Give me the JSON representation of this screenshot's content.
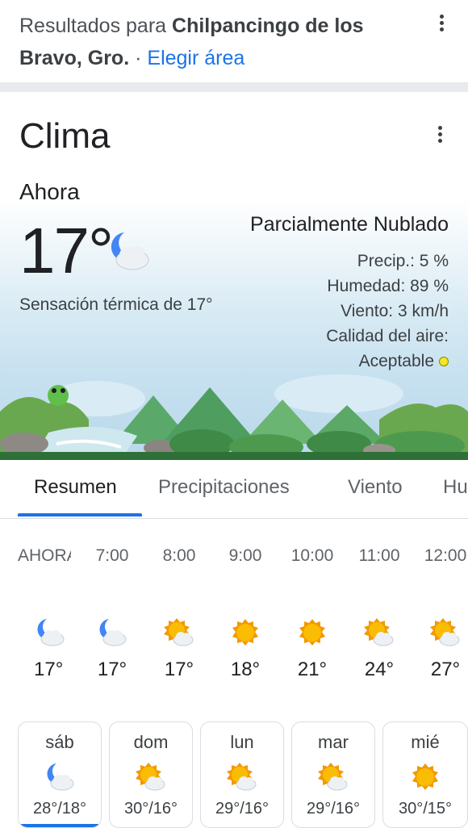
{
  "header": {
    "results_prefix": "Resultados para",
    "location_line1": "Chilpancingo de los",
    "location_line2": "Bravo, Gro.",
    "dot": "·",
    "choose_area": "Elegir área"
  },
  "weather": {
    "title": "Clima",
    "now_label": "Ahora",
    "temperature": "17°",
    "current_icon": "moon-cloud-icon",
    "feels_like": "Sensación térmica de 17°",
    "condition": "Parcialmente Nublado",
    "precip": "Precip.: 5 %",
    "humidity": "Humedad: 89 %",
    "wind": "Viento: 3 km/h",
    "air_quality_label": "Calidad del aire:",
    "air_quality_value": "Aceptable",
    "air_quality_color": "#f5e81e"
  },
  "tabs": [
    {
      "label": "Resumen",
      "active": true
    },
    {
      "label": "Precipitaciones",
      "active": false
    },
    {
      "label": "Viento",
      "active": false
    },
    {
      "label": "Hu",
      "active": false
    }
  ],
  "hourly": [
    {
      "time": "AHORA",
      "icon": "moon-cloud-icon",
      "temp": "17°"
    },
    {
      "time": "7:00",
      "icon": "moon-cloud-icon",
      "temp": "17°"
    },
    {
      "time": "8:00",
      "icon": "sun-cloud-icon",
      "temp": "17°"
    },
    {
      "time": "9:00",
      "icon": "sun-icon",
      "temp": "18°"
    },
    {
      "time": "10:00",
      "icon": "sun-icon",
      "temp": "21°"
    },
    {
      "time": "11:00",
      "icon": "sun-cloud-icon",
      "temp": "24°"
    },
    {
      "time": "12:00",
      "icon": "sun-cloud-icon",
      "temp": "27°"
    }
  ],
  "daily": [
    {
      "day": "sáb",
      "icon": "moon-cloud-icon",
      "temps": "28°/18°",
      "selected": true
    },
    {
      "day": "dom",
      "icon": "sun-cloud-icon",
      "temps": "30°/16°",
      "selected": false
    },
    {
      "day": "lun",
      "icon": "sun-cloud-icon",
      "temps": "29°/16°",
      "selected": false
    },
    {
      "day": "mar",
      "icon": "sun-cloud-icon",
      "temps": "29°/16°",
      "selected": false
    },
    {
      "day": "mié",
      "icon": "sun-icon",
      "temps": "30°/15°",
      "selected": false
    }
  ],
  "colors": {
    "accent": "#1a73e8",
    "sun": "#f29900",
    "moon": "#4285f4"
  }
}
